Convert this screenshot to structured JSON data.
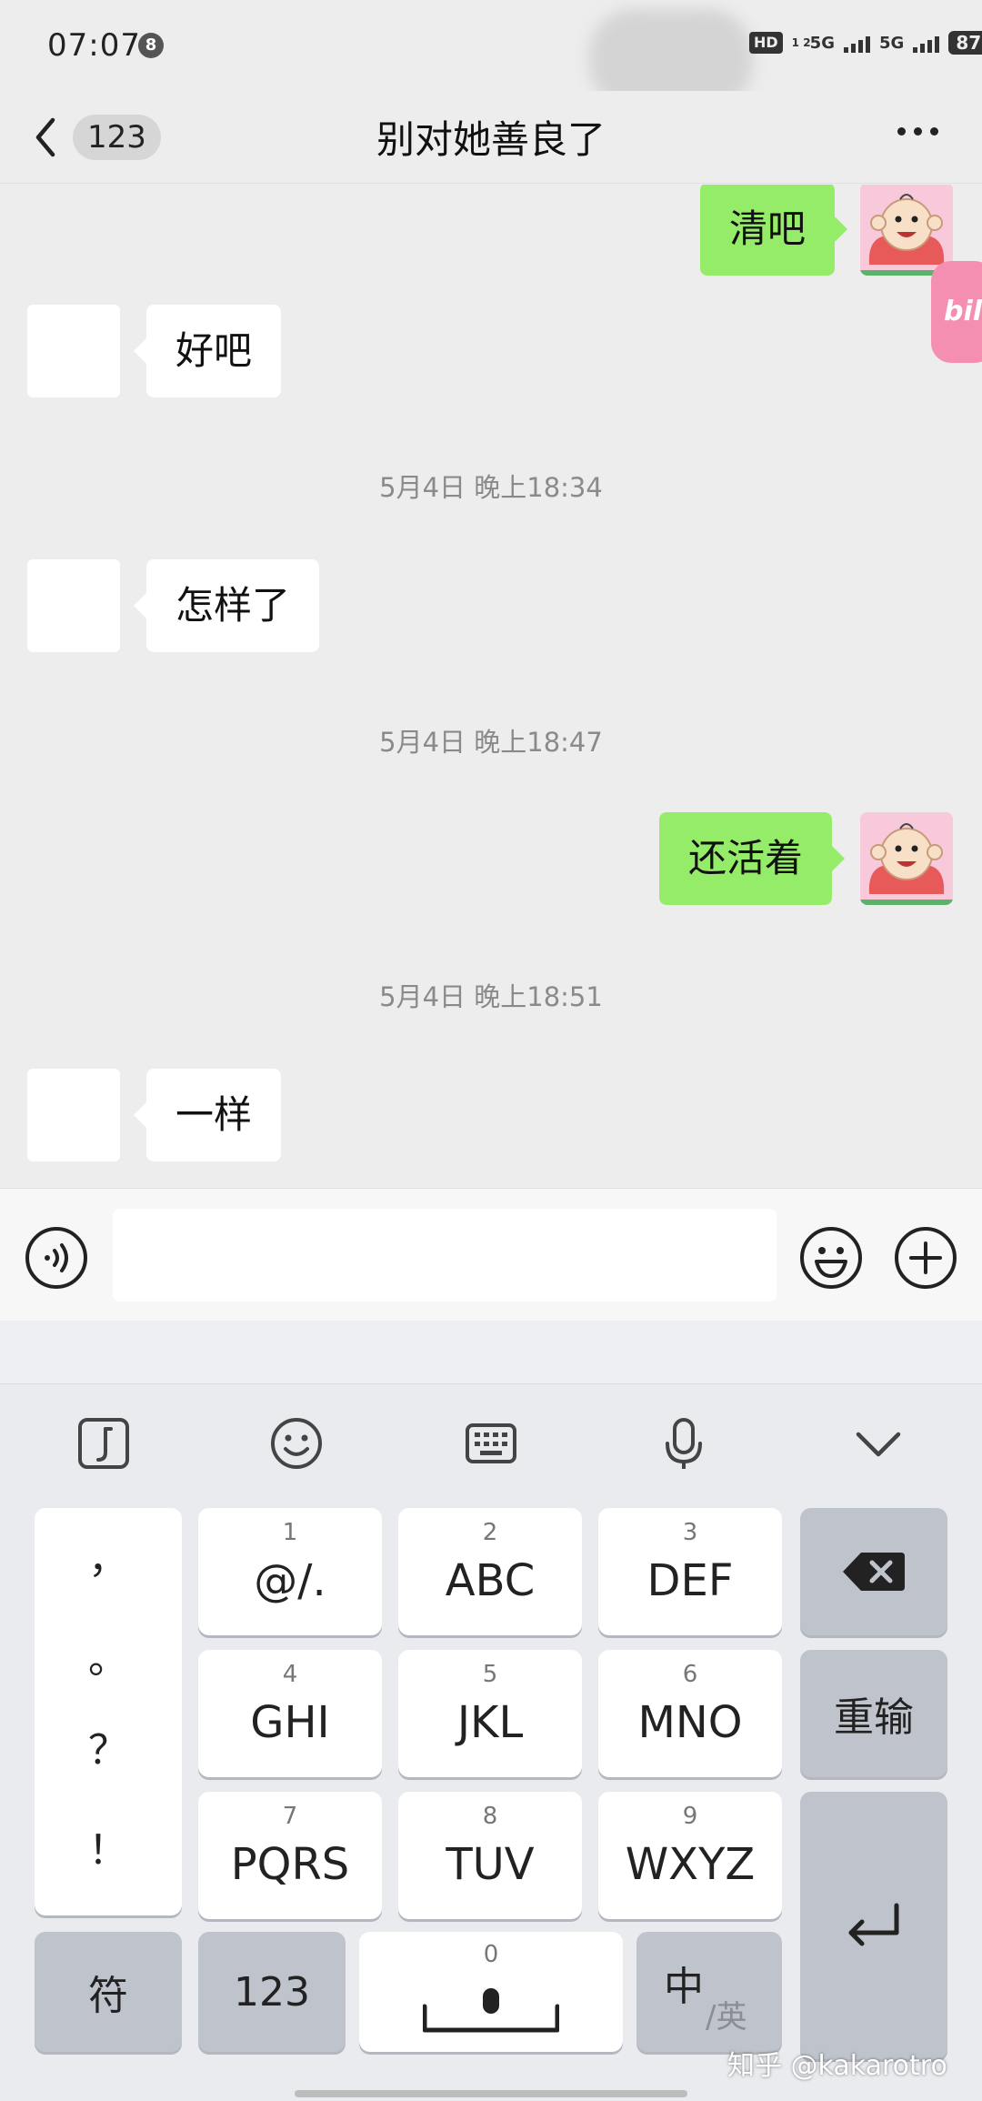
{
  "status_bar": {
    "time": "07:07",
    "notification_count": "8",
    "hd_label": "HD",
    "hd_sub": "1 2",
    "net1": "5G",
    "net2": "5G",
    "battery": "87"
  },
  "nav": {
    "unread_count": "123",
    "title": "别对她善良了"
  },
  "floating_tab": {
    "label": "bili"
  },
  "messages": [
    {
      "side": "me",
      "text": "清吧"
    },
    {
      "side": "other",
      "text": "好吧"
    },
    {
      "type": "timestamp",
      "text": "5月4日 晚上18:34"
    },
    {
      "side": "other",
      "text": "怎样了"
    },
    {
      "type": "timestamp",
      "text": "5月4日 晚上18:47"
    },
    {
      "side": "me",
      "text": "还活着"
    },
    {
      "type": "timestamp",
      "text": "5月4日 晚上18:51"
    },
    {
      "side": "other",
      "text": "一样"
    }
  ],
  "input": {
    "value": "",
    "placeholder": ""
  },
  "keyboard": {
    "toolbar": [
      "music-note-icon",
      "emoji-face-icon",
      "keyboard-icon",
      "microphone-icon",
      "collapse-chevron-icon"
    ],
    "punctuation": [
      "，",
      "。",
      "？",
      "！"
    ],
    "keys": [
      {
        "num": "1",
        "label": "@/."
      },
      {
        "num": "2",
        "label": "ABC"
      },
      {
        "num": "3",
        "label": "DEF"
      },
      {
        "num": "4",
        "label": "GHI"
      },
      {
        "num": "5",
        "label": "JKL"
      },
      {
        "num": "6",
        "label": "MNO"
      },
      {
        "num": "7",
        "label": "PQRS"
      },
      {
        "num": "8",
        "label": "TUV"
      },
      {
        "num": "9",
        "label": "WXYZ"
      }
    ],
    "reinput_label": "重输",
    "symbol_label": "符",
    "numbers_label": "123",
    "space_num": "0",
    "lang_main": "中",
    "lang_alt": "/英"
  },
  "watermark": "知乎 @kakarotro",
  "colors": {
    "sent_bubble": "#95ec69",
    "received_bubble": "#ffffff",
    "chat_bg": "#ededed",
    "keyboard_bg": "#e9ebef"
  }
}
